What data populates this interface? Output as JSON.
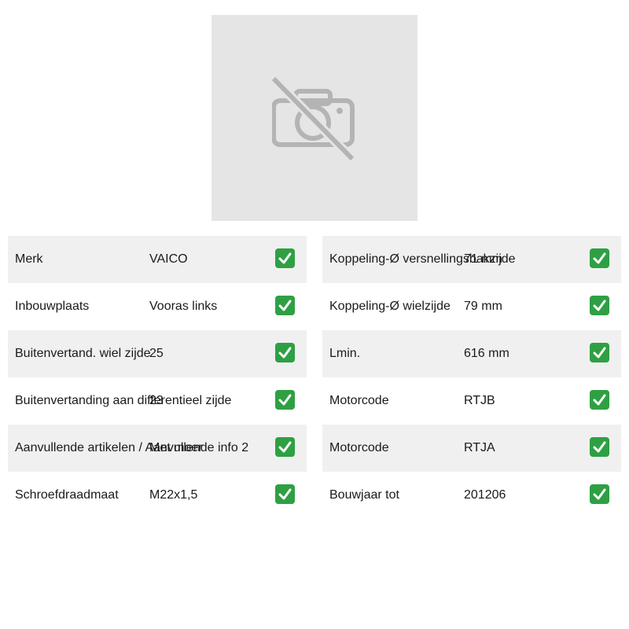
{
  "product": {
    "image_icon": "no-photo-icon"
  },
  "specs_left": [
    {
      "label": "Merk",
      "value": "VAICO",
      "status_icon": "check-icon"
    },
    {
      "label": "Inbouwplaats",
      "value": "Vooras links",
      "status_icon": "check-icon"
    },
    {
      "label": "Buitenvertand. wiel zijde",
      "value": "25",
      "status_icon": "check-icon"
    },
    {
      "label": "Buitenvertanding aan differentieel zijde",
      "value": "23",
      "status_icon": "check-icon"
    },
    {
      "label": "Aanvullende artikelen / Aanvullende info 2",
      "value": "Met moer",
      "status_icon": "check-icon"
    },
    {
      "label": "Schroefdraadmaat",
      "value": "M22x1,5",
      "status_icon": "check-icon"
    }
  ],
  "specs_right": [
    {
      "label": "Koppeling-Ø versnellingsbakzijde",
      "value": "71 mm",
      "status_icon": "check-icon"
    },
    {
      "label": "Koppeling-Ø wielzijde",
      "value": "79 mm",
      "status_icon": "check-icon"
    },
    {
      "label": "Lmin.",
      "value": "616 mm",
      "status_icon": "check-icon"
    },
    {
      "label": "Motorcode",
      "value": "RTJB",
      "status_icon": "check-icon"
    },
    {
      "label": "Motorcode",
      "value": "RTJA",
      "status_icon": "check-icon"
    },
    {
      "label": "Bouwjaar tot",
      "value": "201206",
      "status_icon": "check-icon"
    }
  ],
  "colors": {
    "row_shade": "#f0f0f0",
    "check_green": "#2ea043",
    "placeholder_bg": "#e5e5e5",
    "placeholder_icon": "#b4b4b4"
  }
}
